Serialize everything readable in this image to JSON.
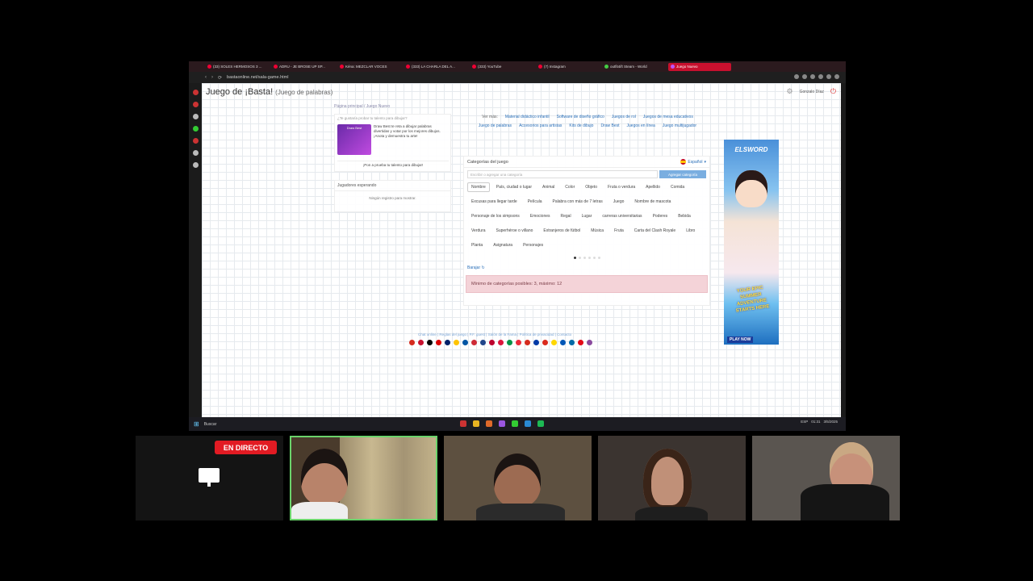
{
  "browser": {
    "tabs": [
      {
        "label": "(33) SOLES HERMOSOS 3 ..."
      },
      {
        "label": "ADRU - JE BROSE UP SP..."
      },
      {
        "label": "Kéna: MEZCLAR VOCES"
      },
      {
        "label": "(333) LA CHARLA DEL A..."
      },
      {
        "label": "(333) YouTube"
      },
      {
        "label": "(7) Instagram"
      },
      {
        "label": "outfit4ift Steam - World"
      },
      {
        "label": "Juego Nuevo"
      }
    ],
    "address": "bastaonline.net/sala-game.html"
  },
  "page": {
    "title": "Juego de ¡Basta!",
    "subtitle": "(Juego de palabras)",
    "user": "Gonzalo Díaz"
  },
  "breadcrumb": "Página principal  /  Juego Nuevo",
  "promo": {
    "question": "¿Te gustaría probar tu talento para dibujar?",
    "thumb_title": "Draw Best",
    "description": "Draw Best te reta a dibujar palabras divertidas y votar por los mejores dibujos. ¡Anota y demuestra tu arte!",
    "cta": "¡Pon a prueba tu talento para dibujar!"
  },
  "waiting": {
    "heading": "Jugadores esperando",
    "empty": "Ningún registro para mostrar."
  },
  "links": {
    "more_label": "Ver más:",
    "items": [
      "Material didáctico infantil",
      "Software de diseño gráfico",
      "Juegos de rol",
      "Juegos de mesa educativos",
      "Juego de palabras",
      "Accesorios para artistas",
      "Kits de dibujo",
      "Draw Best",
      "Juegos en línea",
      "Juego multijugador"
    ]
  },
  "categories": {
    "heading": "Categorías del juego",
    "language": "Español",
    "input_placeholder": "Escribir o agregar una categoría",
    "add_button": "Agregar categoría",
    "chips": [
      "Nombre",
      "País, ciudad o lugar",
      "Animal",
      "Color",
      "Objeto",
      "Fruta o verdura",
      "Apellido",
      "Comida",
      "Excusas para llegar tarde",
      "Película",
      "Palabra con más de 7 letras",
      "Juego",
      "Nombre de mascota",
      "Personaje de los simpsons",
      "Emociones",
      "Regal",
      "Lugar",
      "carreras universitarias",
      "Poderes",
      "Bebida",
      "Verdura",
      "Superhéroe o villano",
      "Extranjeros de fútbol",
      "Música",
      "Fruta",
      "Carta del Clash Royale",
      "Libro",
      "Planta",
      "Asignatura",
      "Personajes"
    ],
    "shuffle": "Barajar",
    "alert": "Mínimo de categorías posibles: 3, máximo: 12"
  },
  "ad": {
    "brand": "ELSWORD",
    "slogan": "YOUR EPIC SUMMER ADVENTURE STARTS HERE",
    "cta": "PLAY NOW"
  },
  "footer": {
    "links": "Chat online | Reglas del juego | P.F. guest | Salón de la Fama | Política de privacidad | Contacto"
  },
  "taskbar": {
    "search": "Buscar",
    "lang": "ESP",
    "time": "01:31",
    "date": "3/5/2025"
  },
  "stream": {
    "live_label": "EN DIRECTO"
  },
  "colors": {
    "accent_red": "#c8102e",
    "link_blue": "#2a6fb8",
    "live_red": "#e21b23",
    "speaking_green": "#6bd36b",
    "alert_bg": "#f4d3d8"
  }
}
